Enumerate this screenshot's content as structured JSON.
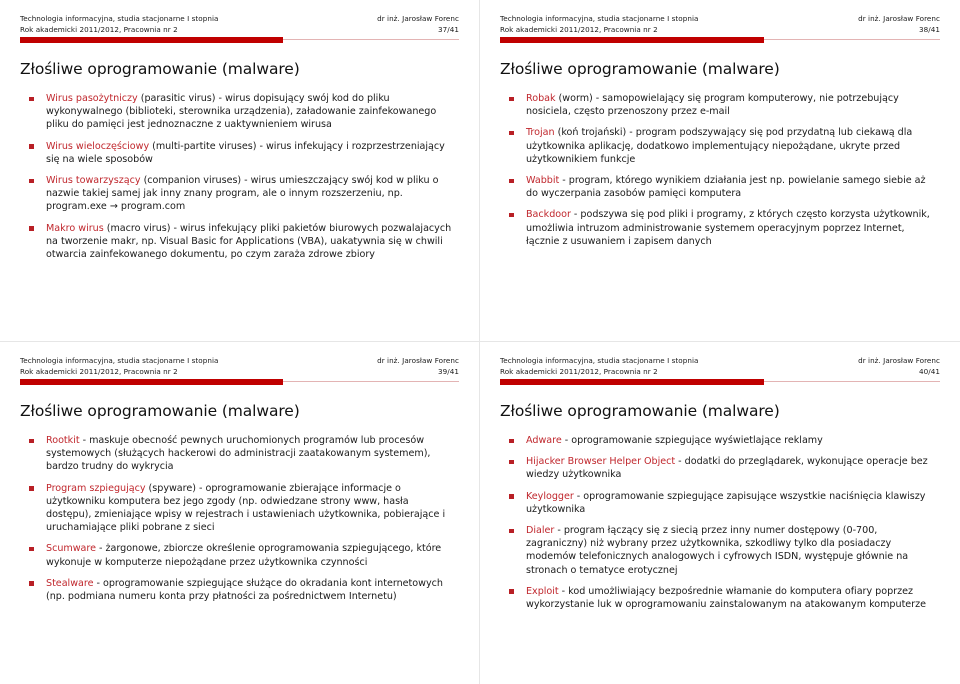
{
  "document": {
    "kind": "lecture-handout",
    "accent_color": "#c00000",
    "term_color": "#c0272d",
    "bullet_color": "#b81f25",
    "rule_light_color": "#e3b4b4"
  },
  "header_common": {
    "line1": "Technologia informacyjna, studia stacjonarne I stopnia",
    "line2": "Rok akademicki 2011/2012, Pracownia nr 2",
    "author": "dr inż. Jarosław Forenc"
  },
  "slides": [
    {
      "page": "37/41",
      "title": "Złośliwe oprogramowanie (malware)",
      "bullets": [
        {
          "term": "Wirus pasożytniczy",
          "rest": " (parasitic virus) - wirus dopisujący swój kod do pliku wykonywalnego (biblioteki, sterownika urządzenia), załadowanie zainfekowanego pliku do pamięci jest jednoznaczne z uaktywnieniem wirusa"
        },
        {
          "term": "Wirus wieloczęściowy",
          "rest": " (multi-partite viruses) - wirus infekujący i rozprzestrzeniający się na wiele sposobów"
        },
        {
          "term": "Wirus towarzyszący",
          "rest": " (companion viruses) - wirus umieszczający swój kod w pliku o nazwie takiej samej jak inny znany program, ale o innym rozszerzeniu, np. program.exe → program.com"
        },
        {
          "term": "Makro wirus",
          "rest": " (macro virus) - wirus infekujący pliki pakietów biurowych pozwalajacych na tworzenie makr, np. Visual Basic for Applications (VBA), uakatywnia się w chwili otwarcia zainfekowanego dokumentu, po czym zaraża zdrowe zbiory"
        }
      ]
    },
    {
      "page": "38/41",
      "title": "Złośliwe oprogramowanie (malware)",
      "bullets": [
        {
          "term": "Robak",
          "rest": " (worm) - samopowielający się program komputerowy, nie potrzebujący nosiciela, często przenoszony przez e-mail"
        },
        {
          "term": "Trojan",
          "rest": " (koń trojański) - program podszywający się pod przydatną lub ciekawą dla użytkownika aplikację, dodatkowo implementujący niepożądane, ukryte przed użytkownikiem funkcje"
        },
        {
          "term": "Wabbit",
          "rest": " - program, którego wynikiem działania jest np. powielanie samego siebie aż do wyczerpania zasobów pamięci komputera"
        },
        {
          "term": "Backdoor",
          "rest": " - podszywa się pod pliki i programy, z których często korzysta użytkownik, umożliwia intruzom administrowanie systemem operacyjnym poprzez Internet, łącznie z usuwaniem i zapisem danych"
        }
      ]
    },
    {
      "page": "39/41",
      "title": "Złośliwe oprogramowanie (malware)",
      "bullets": [
        {
          "term": "Rootkit",
          "rest": " - maskuje obecność pewnych uruchomionych programów lub procesów systemowych (służących hackerowi do administracji zaatakowanym systemem), bardzo trudny do wykrycia"
        },
        {
          "term": "Program szpiegujący",
          "rest": " (spyware) - oprogramowanie zbierające informacje o użytkowniku komputera bez jego zgody (np. odwiedzane strony www, hasła dostępu), zmieniające wpisy w rejestrach i ustawieniach użytkownika, pobierające i uruchamiające pliki pobrane z sieci"
        },
        {
          "term": "Scumware",
          "rest": " - żargonowe, zbiorcze określenie oprogramowania szpiegującego, które wykonuje w komputerze niepożądane przez użytkownika czynności"
        },
        {
          "term": "Stealware",
          "rest": " - oprogramowanie szpiegujące służące do okradania kont internetowych (np. podmiana numeru konta przy płatności za pośrednictwem Internetu)"
        }
      ]
    },
    {
      "page": "40/41",
      "title": "Złośliwe oprogramowanie (malware)",
      "bullets": [
        {
          "term": "Adware",
          "rest": " - oprogramowanie szpiegujące wyświetlające reklamy"
        },
        {
          "term": "Hijacker Browser Helper Object",
          "rest": " - dodatki do przeglądarek, wykonujące operacje bez wiedzy użytkownika"
        },
        {
          "term": "Keylogger",
          "rest": " - oprogramowanie szpiegujące zapisujące wszystkie naciśnięcia klawiszy użytkownika"
        },
        {
          "term": "Dialer",
          "rest": " - program łączący się z siecią przez inny numer dostępowy (0-700, zagraniczny) niż wybrany przez użytkownika, szkodliwy tylko dla posiadaczy modemów telefonicznych analogowych i cyfrowych ISDN, występuje głównie na stronach o tematyce erotycznej"
        },
        {
          "term": "Exploit",
          "rest": " - kod umożliwiający bezpośrednie włamanie do komputera ofiary poprzez wykorzystanie luk w oprogramowaniu zainstalowanym na atakowanym komputerze"
        }
      ]
    }
  ]
}
